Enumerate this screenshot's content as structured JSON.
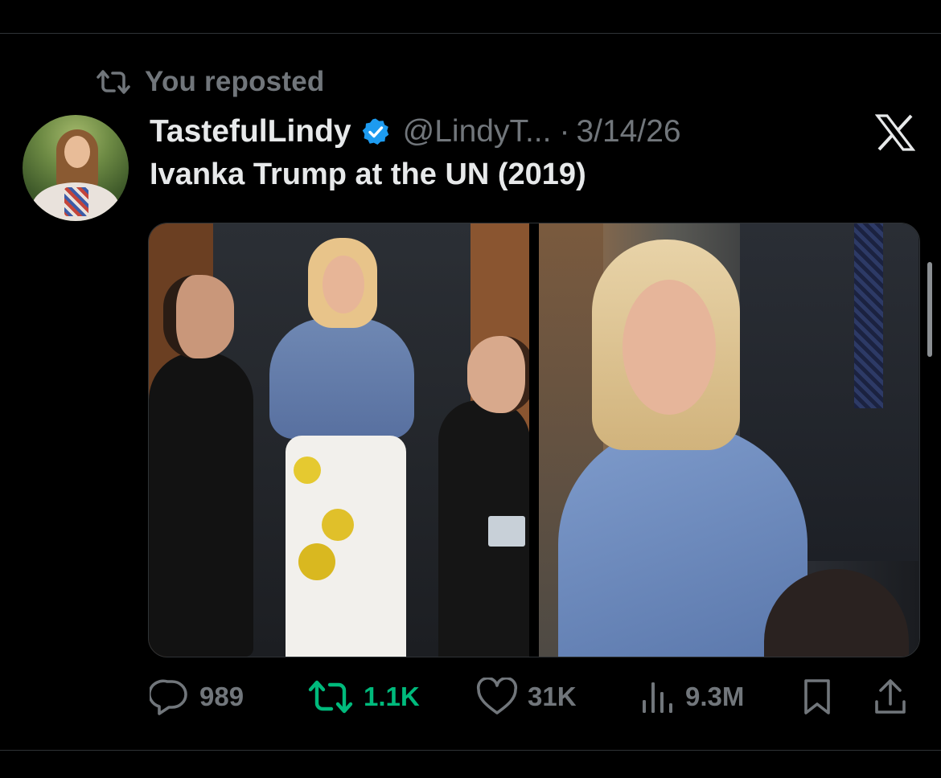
{
  "repost_banner": {
    "label": "You reposted",
    "icon": "repost-icon"
  },
  "author": {
    "display_name": "TastefulLindy",
    "verified": true,
    "handle": "@LindyT...",
    "separator": "·",
    "date": "3/14/26",
    "avatar": "avatar"
  },
  "post": {
    "text": "Ivanka Trump at the UN (2019)",
    "media": [
      {
        "kind": "photo",
        "name": "media-photo-left"
      },
      {
        "kind": "photo",
        "name": "media-photo-right"
      }
    ]
  },
  "actions": {
    "replies": {
      "icon": "reply-icon",
      "count": "989"
    },
    "reposts": {
      "icon": "repost-icon",
      "count": "1.1K",
      "active": true
    },
    "likes": {
      "icon": "heart-icon",
      "count": "31K"
    },
    "views": {
      "icon": "views-icon",
      "count": "9.3M"
    },
    "bookmark": {
      "icon": "bookmark-icon"
    },
    "share": {
      "icon": "share-icon"
    }
  },
  "colors": {
    "background": "#000000",
    "primary_text": "#e7e9ea",
    "secondary_text": "#71767b",
    "verified": "#1d9bf0",
    "repost_active": "#00ba7c",
    "border": "#2f3336"
  },
  "brand": {
    "logo": "x-logo"
  }
}
